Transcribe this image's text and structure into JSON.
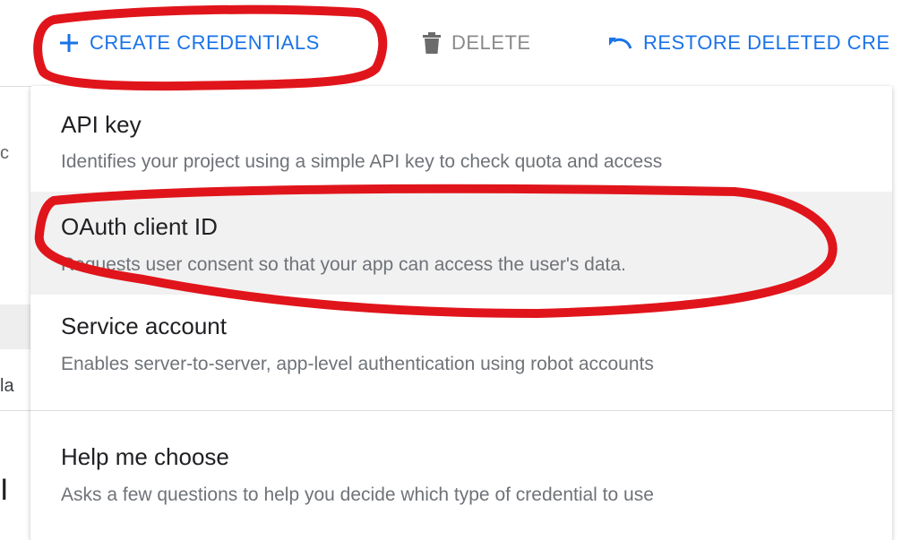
{
  "toolbar": {
    "create_label": "CREATE CREDENTIALS",
    "create_icon": "plus-icon",
    "delete_label": "DELETE",
    "delete_icon": "trash-icon",
    "restore_label": "RESTORE DELETED CRE",
    "restore_icon": "undo-icon",
    "accent_color": "#1a73e8",
    "disabled_color": "#8a8a8a"
  },
  "background": {
    "fragment_1": "c",
    "fragment_2": "la",
    "fragment_3": "I"
  },
  "menu": {
    "items": [
      {
        "title": "API key",
        "description": "Identifies your project using a simple API key to check quota and access"
      },
      {
        "title": "OAuth client ID",
        "description": "Requests user consent so that your app can access the user's data."
      },
      {
        "title": "Service account",
        "description": "Enables server-to-server, app-level authentication using robot accounts"
      },
      {
        "title": "Help me choose",
        "description": "Asks a few questions to help you decide which type of credential to use"
      }
    ],
    "hovered_item": "OAuth client ID"
  },
  "annotation": {
    "color": "#e0151b"
  }
}
